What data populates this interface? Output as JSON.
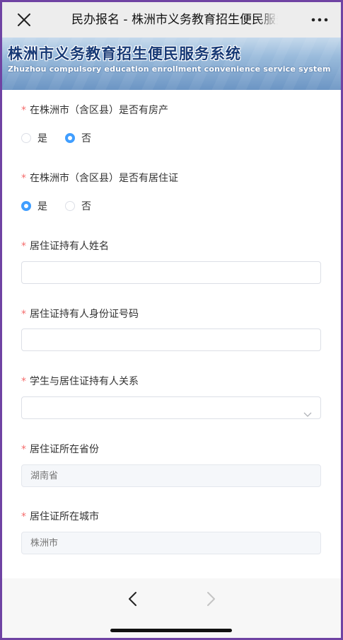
{
  "header": {
    "title": "民办报名 - 株洲市义务教育招生便民服务系统",
    "close_icon": "close-icon",
    "more_icon": "more-icon"
  },
  "banner": {
    "title_cn": "株洲市义务教育招生便民服务系统",
    "title_en": "Zhuzhou compulsory education enrollment convenience service system"
  },
  "form": {
    "required_mark": "*",
    "has_property": {
      "label": "在株洲市（含区县）是否有房产",
      "options": [
        "是",
        "否"
      ],
      "selected": "否"
    },
    "has_residence_permit": {
      "label": "在株洲市（含区县）是否有居住证",
      "options": [
        "是",
        "否"
      ],
      "selected": "是"
    },
    "holder_name": {
      "label": "居住证持有人姓名",
      "value": ""
    },
    "holder_id": {
      "label": "居住证持有人身份证号码",
      "value": ""
    },
    "relation": {
      "label": "学生与居住证持有人关系",
      "value": ""
    },
    "province": {
      "label": "居住证所在省份",
      "placeholder": "湖南省"
    },
    "city": {
      "label": "居住证所在城市",
      "placeholder": "株洲市"
    }
  },
  "footer": {
    "back_icon": "chevron-left-icon",
    "forward_icon": "chevron-right-icon"
  },
  "colors": {
    "accent": "#409eff",
    "required": "#f56c6c",
    "frame": "#6f43a3"
  }
}
